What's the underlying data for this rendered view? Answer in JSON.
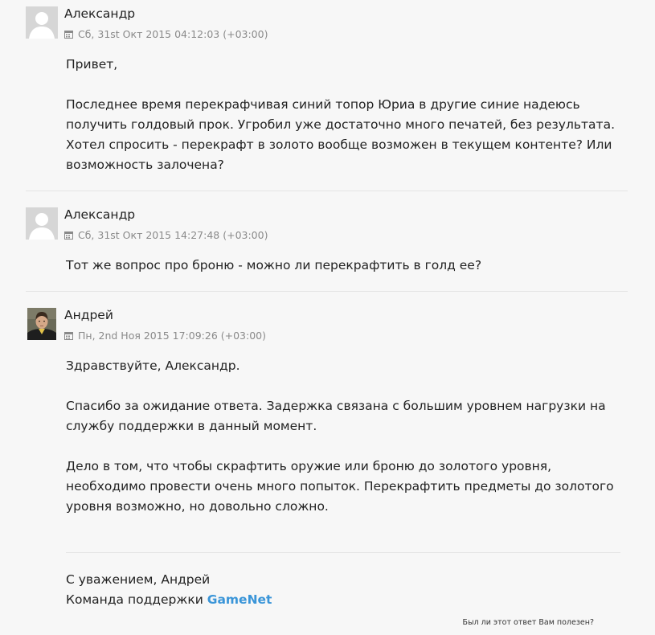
{
  "messages": [
    {
      "author": "Александр",
      "timestamp": "Сб, 31st Окт 2015 04:12:03 (+03:00)",
      "avatar": "default-user-silhouette",
      "paragraphs": [
        [
          "Привет,"
        ],
        [
          "Последнее время перекрафчивая синий топор Юриа в другие синие надеюсь",
          "получить голдовый прок. Угробил уже достаточно много печатей, без результата.",
          "Хотел спросить - перекрафт в золото вообще возможен в текущем контенте? Или",
          "возможность залочена?"
        ]
      ]
    },
    {
      "author": "Александр",
      "timestamp": "Сб, 31st Окт 2015 14:27:48 (+03:00)",
      "avatar": "default-user-silhouette",
      "paragraphs": [
        [
          "Тот же вопрос про броню - можно ли перекрафтить в голд ее?"
        ]
      ]
    },
    {
      "author": "Андрей",
      "timestamp": "Пн, 2nd Ноя 2015 17:09:26 (+03:00)",
      "avatar": "agent-photo",
      "paragraphs": [
        [
          "Здравствуйте, Александр."
        ],
        [
          "Спасибо за ожидание ответа. Задержка связана с большим уровнем нагрузки на",
          "службу поддержки в данный момент."
        ],
        [
          "Дело в том, что чтобы скрафтить оружие или броню до золотого уровня,",
          "необходимо провести очень много попыток. Перекрафтить предметы до золотого",
          "уровня возможно, но довольно сложно."
        ]
      ],
      "signature": {
        "line1": "С уважением, Андрей",
        "line2_prefix": "Команда поддержки",
        "brand": "GameNet"
      },
      "helpful_prompt": "Был ли этот ответ Вам полезен?"
    }
  ],
  "colors": {
    "background": "#f7f7f7",
    "text": "#222222",
    "meta": "#8a8a8a",
    "divider": "#e5e5e5",
    "brand": "#3a95d8"
  }
}
